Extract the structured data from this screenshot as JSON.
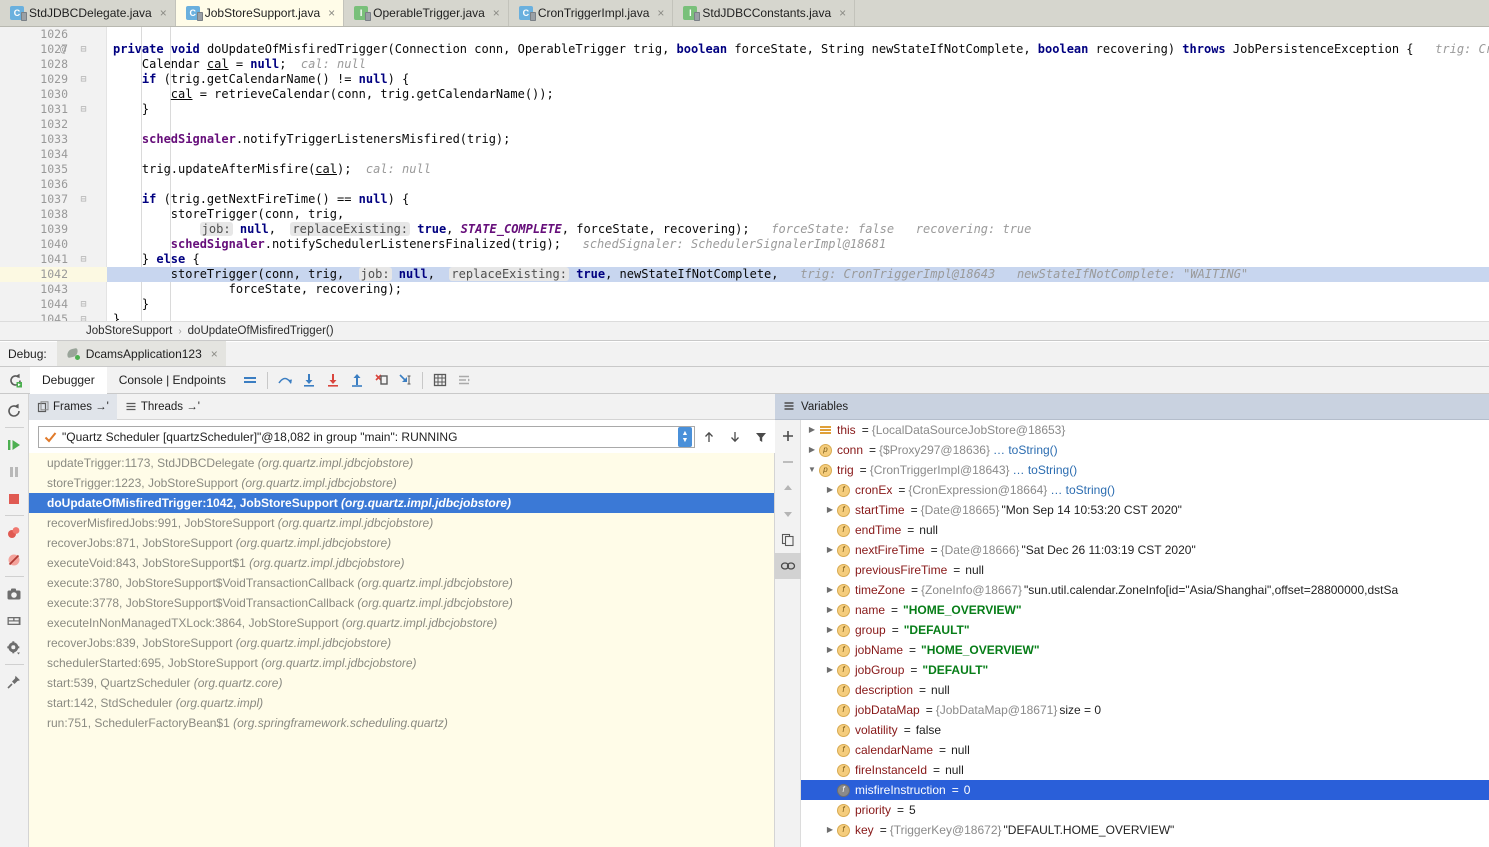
{
  "editor_tabs": [
    {
      "label": "StdJDBCDelegate.java",
      "icon": "java-class-icon",
      "kind": "class",
      "active": false
    },
    {
      "label": "JobStoreSupport.java",
      "icon": "java-class-icon",
      "kind": "class",
      "active": true
    },
    {
      "label": "OperableTrigger.java",
      "icon": "java-interface-icon",
      "kind": "interface",
      "active": false
    },
    {
      "label": "CronTriggerImpl.java",
      "icon": "java-class-icon",
      "kind": "class",
      "active": false
    },
    {
      "label": "StdJDBCConstants.java",
      "icon": "java-interface-icon",
      "kind": "interface",
      "active": false
    }
  ],
  "code": {
    "lines": [
      {
        "num": "1026",
        "mark": "",
        "fold": "",
        "html": ""
      },
      {
        "num": "1027",
        "mark": "@",
        "fold": "-",
        "html": "<span class=\"kw\">private</span> <span class=\"kw\">void</span> doUpdateOfMisfiredTrigger(Connection conn, OperableTrigger trig, <span class=\"kw\">boolean</span> forceState, String newStateIfNotComplete, <span class=\"kw\">boolean</span> recovering) <span class=\"kw\">throws</span> JobPersistenceException {   <span class=\"hint\">trig: CronTrigg</span>"
      },
      {
        "num": "1028",
        "mark": "",
        "fold": "",
        "html": "    Calendar <span class=\"undl\">cal</span> = <span class=\"kw\">null</span>;  <span class=\"hint\">cal: null</span>"
      },
      {
        "num": "1029",
        "mark": "",
        "fold": "-",
        "html": "    <span class=\"kw\">if</span> (trig.getCalendarName() != <span class=\"kw\">null</span>) {"
      },
      {
        "num": "1030",
        "mark": "",
        "fold": "",
        "html": "        <span class=\"undl\">cal</span> = retrieveCalendar(conn, trig.getCalendarName());"
      },
      {
        "num": "1031",
        "mark": "",
        "fold": "-",
        "html": "    }"
      },
      {
        "num": "1032",
        "mark": "",
        "fold": "",
        "html": ""
      },
      {
        "num": "1033",
        "mark": "",
        "fold": "",
        "html": "    <span class=\"fld\">schedSignaler</span>.notifyTriggerListenersMisfired(trig);"
      },
      {
        "num": "1034",
        "mark": "",
        "fold": "",
        "html": ""
      },
      {
        "num": "1035",
        "mark": "",
        "fold": "",
        "html": "    trig.updateAfterMisfire(<span class=\"undl\">cal</span>);  <span class=\"hint\">cal: null</span>"
      },
      {
        "num": "1036",
        "mark": "",
        "fold": "",
        "html": ""
      },
      {
        "num": "1037",
        "mark": "",
        "fold": "-",
        "html": "    <span class=\"kw\">if</span> (trig.getNextFireTime() == <span class=\"kw\">null</span>) {"
      },
      {
        "num": "1038",
        "mark": "",
        "fold": "",
        "html": "        storeTrigger(conn, trig,"
      },
      {
        "num": "1039",
        "mark": "",
        "fold": "",
        "html": "            <span class=\"param\">job:</span> <span class=\"kw\">null</span>,  <span class=\"param\">replaceExisting:</span> <span class=\"kw\">true</span>, <span class=\"stc\">STATE_COMPLETE</span>, forceState, recovering);   <span class=\"hint\">forceState: false   recovering: true</span>"
      },
      {
        "num": "1040",
        "mark": "",
        "fold": "",
        "html": "        <span class=\"fld\">schedSignaler</span>.notifySchedulerListenersFinalized(trig);   <span class=\"hint\">schedSignaler: SchedulerSignalerImpl@18681</span>"
      },
      {
        "num": "1041",
        "mark": "",
        "fold": "-",
        "html": "    } <span class=\"kw\">else</span> {"
      },
      {
        "num": "1042",
        "mark": "",
        "fold": "",
        "highlight": true,
        "html": "        storeTrigger(conn, trig,  <span class=\"param\">job:</span> <span class=\"kw\">null</span>,  <span class=\"param\">replaceExisting:</span> <span class=\"kw\">true</span>, newStateIfNotComplete,   <span class=\"hint\">trig: CronTriggerImpl@18643</span>   <span class=\"hint\">newStateIfNotComplete: \"WAITING\"</span>"
      },
      {
        "num": "1043",
        "mark": "",
        "fold": "",
        "html": "                forceState, recovering);"
      },
      {
        "num": "1044",
        "mark": "",
        "fold": "-",
        "html": "    }"
      },
      {
        "num": "1045",
        "mark": "",
        "fold": "-",
        "html": "}"
      }
    ]
  },
  "breadcrumb": {
    "class": "JobStoreSupport",
    "separator": "›",
    "method": "doUpdateOfMisfiredTrigger()"
  },
  "debug_header": {
    "label": "Debug:",
    "session_tab": "DcamsApplication123",
    "close": "×"
  },
  "debug_toolbar": {
    "tabs": [
      {
        "label": "Debugger",
        "active": true
      },
      {
        "label": "Console | Endpoints",
        "active": false
      }
    ],
    "icons": [
      "show-execution-point-icon",
      "step-over-icon",
      "step-into-icon",
      "force-step-into-icon",
      "step-out-icon",
      "drop-frame-icon",
      "run-to-cursor-icon",
      "evaluate-expression-icon",
      "settings-lines-icon"
    ],
    "rerun_icon": "rerun-icon"
  },
  "left_rail": {
    "buttons": [
      "rerun-icon",
      "resume-program-icon",
      "pause-program-icon",
      "stop-icon",
      "view-breakpoints-icon",
      "mute-breakpoints-icon",
      "camera-icon",
      "layout-icon",
      "settings-gear-icon",
      "pin-icon"
    ]
  },
  "frames_panel": {
    "tabs": [
      {
        "label": "Frames →'",
        "icon": "frames-icon",
        "selected": true
      },
      {
        "label": "Threads →'",
        "icon": "threads-icon",
        "selected": false
      }
    ],
    "thread_selector": {
      "value": "\"Quartz Scheduler [quartzScheduler]\"@18,082 in group \"main\": RUNNING",
      "status_icon": "checkmark-icon"
    },
    "toolbar_icons": [
      "arrow-up-icon",
      "arrow-down-icon",
      "filter-icon"
    ],
    "frames": [
      {
        "method": "updateTrigger:1173, StdJDBCDelegate",
        "package": "(org.quartz.impl.jdbcjobstore)",
        "selected": false
      },
      {
        "method": "storeTrigger:1223, JobStoreSupport",
        "package": "(org.quartz.impl.jdbcjobstore)",
        "selected": false
      },
      {
        "method": "doUpdateOfMisfiredTrigger:1042, JobStoreSupport",
        "package": "(org.quartz.impl.jdbcjobstore)",
        "selected": true
      },
      {
        "method": "recoverMisfiredJobs:991, JobStoreSupport",
        "package": "(org.quartz.impl.jdbcjobstore)",
        "selected": false
      },
      {
        "method": "recoverJobs:871, JobStoreSupport",
        "package": "(org.quartz.impl.jdbcjobstore)",
        "selected": false
      },
      {
        "method": "executeVoid:843, JobStoreSupport$1",
        "package": "(org.quartz.impl.jdbcjobstore)",
        "selected": false
      },
      {
        "method": "execute:3780, JobStoreSupport$VoidTransactionCallback",
        "package": "(org.quartz.impl.jdbcjobstore)",
        "selected": false
      },
      {
        "method": "execute:3778, JobStoreSupport$VoidTransactionCallback",
        "package": "(org.quartz.impl.jdbcjobstore)",
        "selected": false
      },
      {
        "method": "executeInNonManagedTXLock:3864, JobStoreSupport",
        "package": "(org.quartz.impl.jdbcjobstore)",
        "selected": false
      },
      {
        "method": "recoverJobs:839, JobStoreSupport",
        "package": "(org.quartz.impl.jdbcjobstore)",
        "selected": false
      },
      {
        "method": "schedulerStarted:695, JobStoreSupport",
        "package": "(org.quartz.impl.jdbcjobstore)",
        "selected": false
      },
      {
        "method": "start:539, QuartzScheduler",
        "package": "(org.quartz.core)",
        "selected": false
      },
      {
        "method": "start:142, StdScheduler",
        "package": "(org.quartz.impl)",
        "selected": false
      },
      {
        "method": "run:751, SchedulerFactoryBean$1",
        "package": "(org.springframework.scheduling.quartz)",
        "selected": false
      }
    ]
  },
  "variables_panel": {
    "title": "Variables",
    "title_icon": "variables-icon",
    "rail_icons": [
      "plus-icon",
      "minus-icon",
      "up-triangle-icon",
      "down-triangle-icon",
      "copy-icon",
      "watches-icon"
    ],
    "rows": [
      {
        "indent": 0,
        "arrow": "collapsed",
        "icon": "list",
        "icon_letter": "",
        "name": "this",
        "eq": "=",
        "ref": "{LocalDataSourceJobStore@18653}",
        "value": "",
        "value_type": "none",
        "link": "",
        "selected": false
      },
      {
        "indent": 0,
        "arrow": "collapsed",
        "icon": "p",
        "icon_letter": "p",
        "name": "conn",
        "eq": "=",
        "ref": "{$Proxy297@18636}",
        "value": "",
        "value_type": "none",
        "link": "… toString()",
        "selected": false
      },
      {
        "indent": 0,
        "arrow": "expanded",
        "icon": "p",
        "icon_letter": "p",
        "name": "trig",
        "eq": "=",
        "ref": "{CronTriggerImpl@18643}",
        "value": "",
        "value_type": "none",
        "link": "… toString()",
        "selected": false
      },
      {
        "indent": 1,
        "arrow": "collapsed",
        "icon": "f",
        "icon_letter": "f",
        "name": "cronEx",
        "eq": "=",
        "ref": "{CronExpression@18664}",
        "value": "",
        "value_type": "none",
        "link": "… toString()",
        "selected": false
      },
      {
        "indent": 1,
        "arrow": "collapsed",
        "icon": "f",
        "icon_letter": "f",
        "name": "startTime",
        "eq": "=",
        "ref": "{Date@18665}",
        "value": "\"Mon Sep 14 10:53:20 CST 2020\"",
        "value_type": "plain",
        "link": "",
        "selected": false
      },
      {
        "indent": 1,
        "arrow": "none",
        "icon": "f",
        "icon_letter": "f",
        "name": "endTime",
        "eq": "=",
        "ref": "",
        "value": "null",
        "value_type": "plain",
        "link": "",
        "selected": false
      },
      {
        "indent": 1,
        "arrow": "collapsed",
        "icon": "f",
        "icon_letter": "f",
        "name": "nextFireTime",
        "eq": "=",
        "ref": "{Date@18666}",
        "value": "\"Sat Dec 26 11:03:19 CST 2020\"",
        "value_type": "plain",
        "link": "",
        "selected": false
      },
      {
        "indent": 1,
        "arrow": "none",
        "icon": "f",
        "icon_letter": "f",
        "name": "previousFireTime",
        "eq": "=",
        "ref": "",
        "value": "null",
        "value_type": "plain",
        "link": "",
        "selected": false
      },
      {
        "indent": 1,
        "arrow": "collapsed",
        "icon": "f",
        "icon_letter": "f",
        "name": "timeZone",
        "eq": "=",
        "ref": "{ZoneInfo@18667}",
        "value": "\"sun.util.calendar.ZoneInfo[id=\"Asia/Shanghai\",offset=28800000,dstSa",
        "value_type": "plain",
        "link": "",
        "selected": false
      },
      {
        "indent": 1,
        "arrow": "collapsed",
        "icon": "f",
        "icon_letter": "f",
        "name": "name",
        "eq": "=",
        "ref": "",
        "value": "\"HOME_OVERVIEW\"",
        "value_type": "string",
        "link": "",
        "selected": false
      },
      {
        "indent": 1,
        "arrow": "collapsed",
        "icon": "f",
        "icon_letter": "f",
        "name": "group",
        "eq": "=",
        "ref": "",
        "value": "\"DEFAULT\"",
        "value_type": "string",
        "link": "",
        "selected": false
      },
      {
        "indent": 1,
        "arrow": "collapsed",
        "icon": "f",
        "icon_letter": "f",
        "name": "jobName",
        "eq": "=",
        "ref": "",
        "value": "\"HOME_OVERVIEW\"",
        "value_type": "string",
        "link": "",
        "selected": false
      },
      {
        "indent": 1,
        "arrow": "collapsed",
        "icon": "f",
        "icon_letter": "f",
        "name": "jobGroup",
        "eq": "=",
        "ref": "",
        "value": "\"DEFAULT\"",
        "value_type": "string",
        "link": "",
        "selected": false
      },
      {
        "indent": 1,
        "arrow": "none",
        "icon": "f",
        "icon_letter": "f",
        "name": "description",
        "eq": "=",
        "ref": "",
        "value": "null",
        "value_type": "plain",
        "link": "",
        "selected": false
      },
      {
        "indent": 1,
        "arrow": "none",
        "icon": "f",
        "icon_letter": "f",
        "name": "jobDataMap",
        "eq": "=",
        "ref": "{JobDataMap@18671}",
        "value": "size = 0",
        "value_type": "plain",
        "link": "",
        "selected": false
      },
      {
        "indent": 1,
        "arrow": "none",
        "icon": "f",
        "icon_letter": "f",
        "name": "volatility",
        "eq": "=",
        "ref": "",
        "value": "false",
        "value_type": "plain",
        "link": "",
        "selected": false
      },
      {
        "indent": 1,
        "arrow": "none",
        "icon": "f",
        "icon_letter": "f",
        "name": "calendarName",
        "eq": "=",
        "ref": "",
        "value": "null",
        "value_type": "plain",
        "link": "",
        "selected": false
      },
      {
        "indent": 1,
        "arrow": "none",
        "icon": "f",
        "icon_letter": "f",
        "name": "fireInstanceId",
        "eq": "=",
        "ref": "",
        "value": "null",
        "value_type": "plain",
        "link": "",
        "selected": false
      },
      {
        "indent": 1,
        "arrow": "none",
        "icon": "grey",
        "icon_letter": "f",
        "name": "misfireInstruction",
        "eq": "=",
        "ref": "",
        "value": "0",
        "value_type": "plain",
        "link": "",
        "selected": true
      },
      {
        "indent": 1,
        "arrow": "none",
        "icon": "f",
        "icon_letter": "f",
        "name": "priority",
        "eq": "=",
        "ref": "",
        "value": "5",
        "value_type": "plain",
        "link": "",
        "selected": false
      },
      {
        "indent": 1,
        "arrow": "collapsed",
        "icon": "f",
        "icon_letter": "f",
        "name": "key",
        "eq": "=",
        "ref": "{TriggerKey@18672}",
        "value": "\"DEFAULT.HOME_OVERVIEW\"",
        "value_type": "plain",
        "link": "",
        "selected": false
      }
    ]
  },
  "colors": {
    "selection_blue": "#2a5fd9",
    "frame_selection_blue": "#3b79d6",
    "code_highlight": "#c8d6ef",
    "gutter_highlight": "#fcf9e2",
    "frames_bg": "#fffce8",
    "vars_header": "#c9d2e0",
    "string_green": "#067d17",
    "keyword_navy": "#000080",
    "field_purple": "#660e7a",
    "var_name_red": "#871717"
  }
}
